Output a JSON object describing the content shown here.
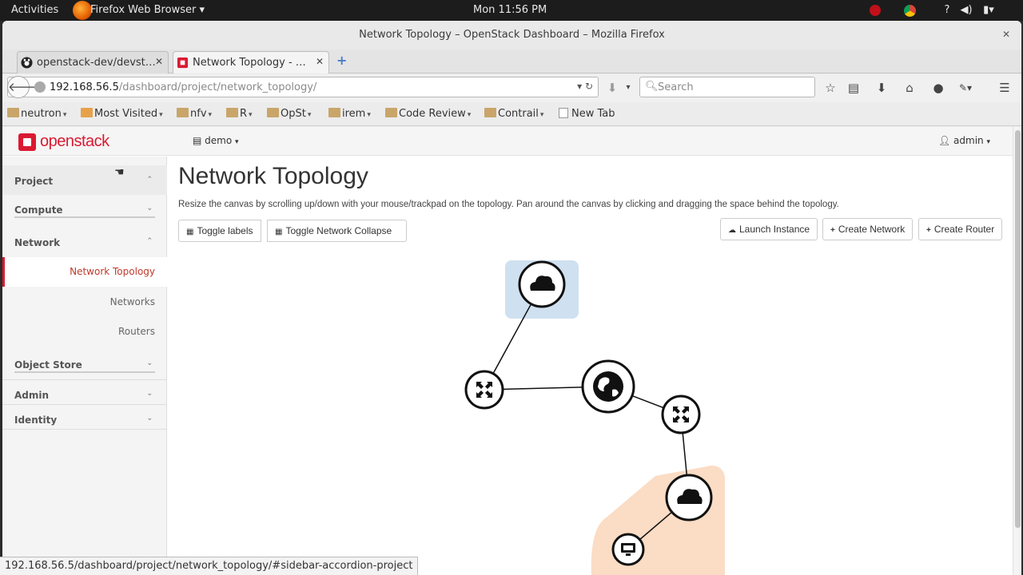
{
  "system_bar": {
    "activities": "Activities",
    "app_name": "Firefox Web Browser",
    "clock": "Mon 11:56 PM"
  },
  "window": {
    "title": "Network Topology – OpenStack Dashboard – Mozilla Firefox"
  },
  "tabs": [
    {
      "label": "openstack-dev/devst…",
      "active": false
    },
    {
      "label": "Network Topology - …",
      "active": true
    }
  ],
  "urlbar": {
    "host": "192.168.56.5",
    "path": "/dashboard/project/network_topology/",
    "search_placeholder": "Search"
  },
  "bookmarks": [
    {
      "label": "neutron",
      "folder": true
    },
    {
      "label": "Most Visited",
      "folder": true
    },
    {
      "label": "nfv",
      "folder": true
    },
    {
      "label": "R",
      "folder": true
    },
    {
      "label": "OpSt",
      "folder": true
    },
    {
      "label": "irem",
      "folder": true
    },
    {
      "label": "Code Review",
      "folder": true
    },
    {
      "label": "Contrail",
      "folder": true
    },
    {
      "label": "New Tab",
      "folder": false
    }
  ],
  "header": {
    "logo_text": "openstack",
    "project": "demo",
    "user": "admin"
  },
  "sidebar": {
    "project": "Project",
    "compute": "Compute",
    "network": "Network",
    "items": [
      "Network Topology",
      "Networks",
      "Routers"
    ],
    "object_store": "Object Store",
    "admin": "Admin",
    "identity": "Identity"
  },
  "main": {
    "title": "Network Topology",
    "description": "Resize the canvas by scrolling up/down with your mouse/trackpad on the topology. Pan around the canvas by clicking and dragging the space behind the topology.",
    "toggle_labels": "Toggle labels",
    "toggle_collapse": "Toggle Network Collapse",
    "launch_instance": "Launch Instance",
    "create_network": "Create Network",
    "create_router": "Create Router"
  },
  "status_url": "192.168.56.5/dashboard/project/network_topology/#sidebar-accordion-project",
  "colors": {
    "brand": "#da1a32",
    "network_blue": "#cfe0f0",
    "network_orange": "#fbdcc4"
  }
}
